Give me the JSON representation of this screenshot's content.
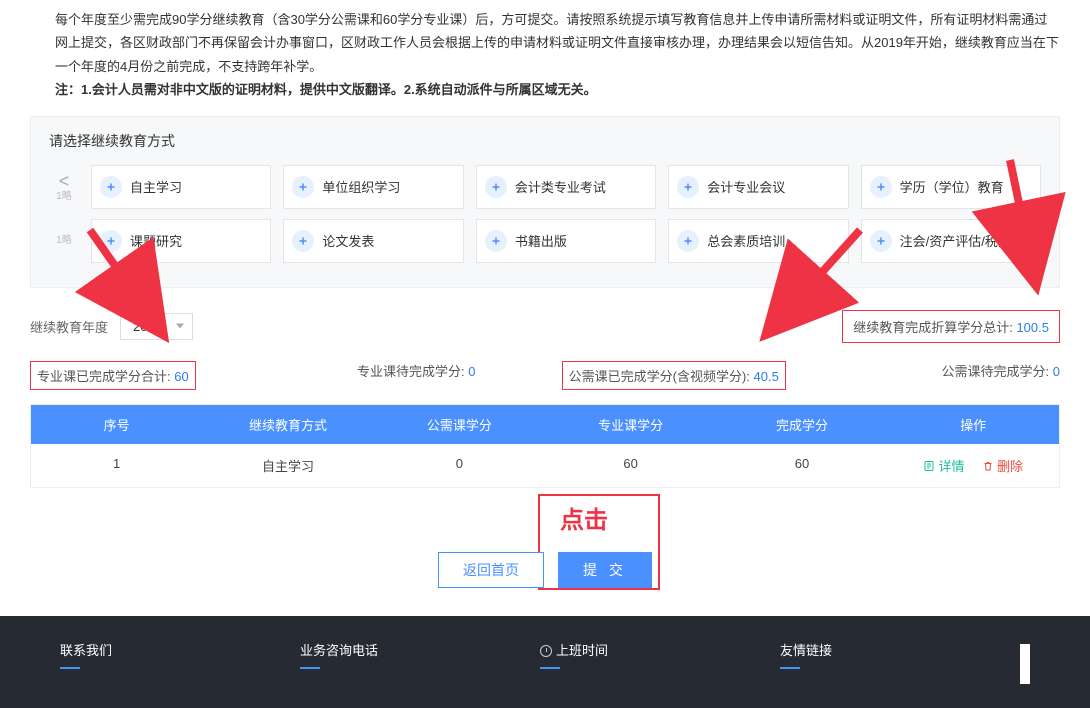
{
  "intro": {
    "p1": "每个年度至少需完成90学分继续教育（含30学分公需课和60学分专业课）后，方可提交。请按照系统提示填写教育信息并上传申请所需材料或证明文件，所有证明材料需通过网上提交，各区财政部门不再保留会计办事窗口，区财政工作人员会根据上传的申请材料或证明文件直接审核办理，办理结果会以短信告知。从2019年开始，继续教育应当在下一个年度的4月份之前完成，不支持跨年补学。",
    "p2": "注：1.会计人员需对非中文版的证明材料，提供中文版翻译。2.系统自动派件与所属区域无关。"
  },
  "panel_title": "请选择继续教育方式",
  "methods_row1": [
    "自主学习",
    "单位组织学习",
    "会计类专业考试",
    "会计专业会议",
    "学历（学位）教育"
  ],
  "methods_row2": [
    "课题研究",
    "论文发表",
    "书籍出版",
    "总会素质培训",
    "注会/资产评估/税务师"
  ],
  "year": {
    "label": "继续教育年度",
    "value": "2022"
  },
  "total": {
    "label": "继续教育完成折算学分总计:",
    "value": "100.5"
  },
  "stats": {
    "s1l": "专业课已完成学分合计:",
    "s1v": "60",
    "s2l": "专业课待完成学分:",
    "s2v": "0",
    "s3l": "公需课已完成学分(含视频学分):",
    "s3v": "40.5",
    "s4l": "公需课待完成学分:",
    "s4v": "0"
  },
  "table": {
    "headers": [
      "序号",
      "继续教育方式",
      "公需课学分",
      "专业课学分",
      "完成学分",
      "操作"
    ],
    "row": {
      "no": "1",
      "method": "自主学习",
      "pub": "0",
      "pro": "60",
      "done": "60",
      "detail": "详情",
      "del": "删除"
    }
  },
  "annot": "点击",
  "btn_back": "返回首页",
  "btn_submit": "提 交",
  "footer": {
    "c1": "联系我们",
    "c2": "业务咨询电话",
    "c3": "上班时间",
    "c4": "友情链接"
  }
}
